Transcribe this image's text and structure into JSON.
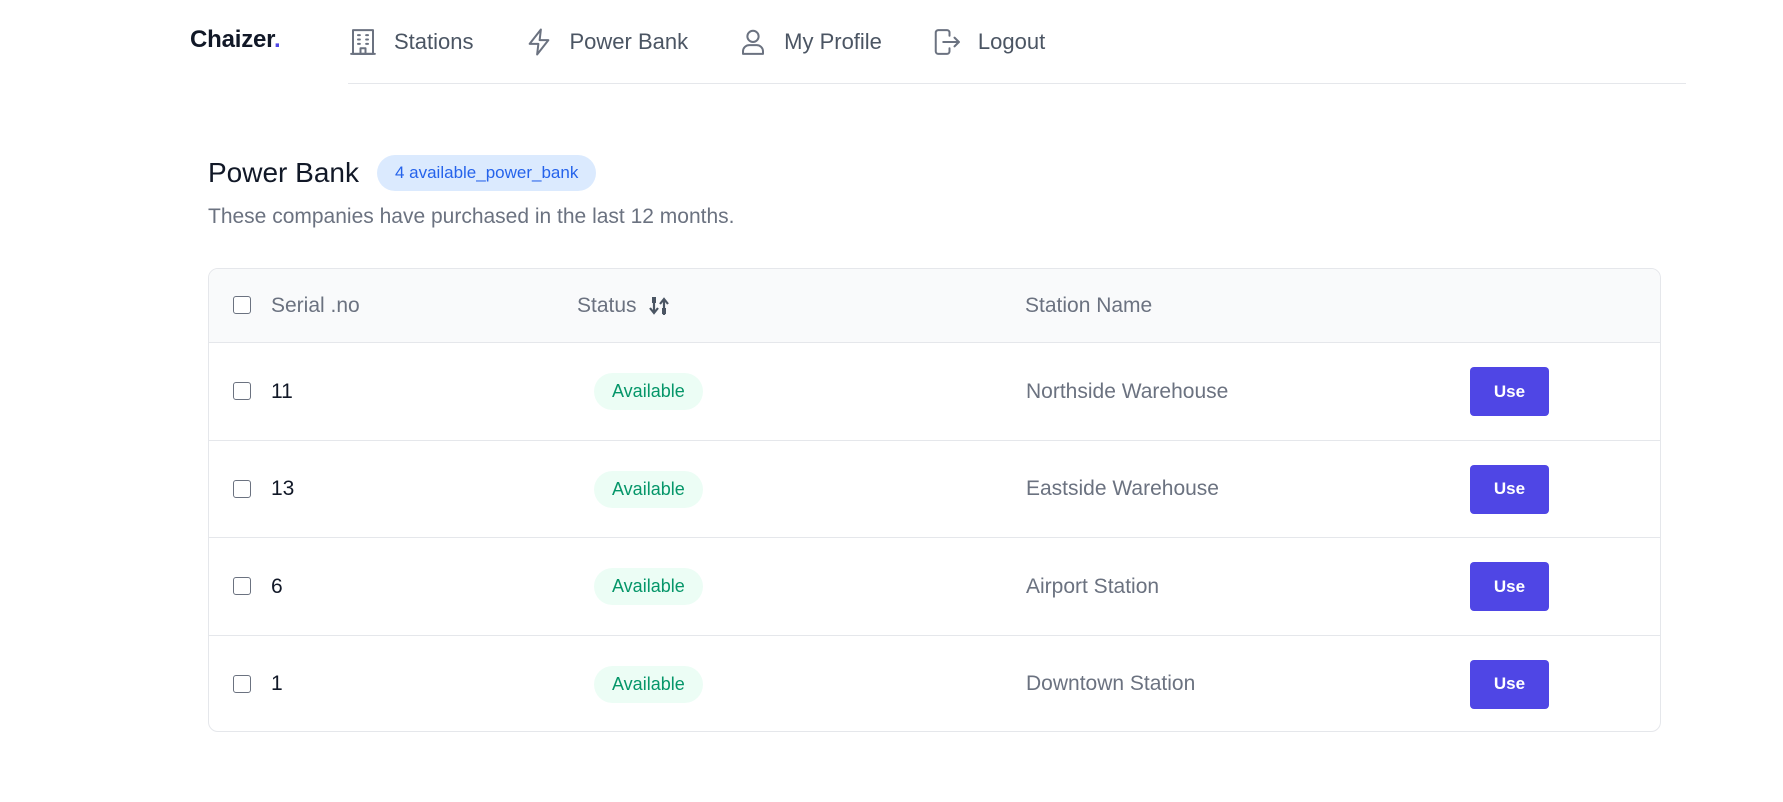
{
  "brand": {
    "name": "Chaizer",
    "dot": "."
  },
  "nav": {
    "items": [
      {
        "label": "Stations",
        "icon": "building-icon"
      },
      {
        "label": "Power Bank",
        "icon": "bolt-icon"
      },
      {
        "label": "My Profile",
        "icon": "user-icon"
      },
      {
        "label": "Logout",
        "icon": "logout-icon"
      }
    ]
  },
  "header": {
    "title": "Power Bank",
    "badge": "4 available_power_bank",
    "subtitle": "These companies have purchased in the last 12 months."
  },
  "table": {
    "columns": {
      "serial": "Serial .no",
      "status": "Status",
      "station": "Station Name"
    },
    "rows": [
      {
        "serial": "11",
        "status": "Available",
        "station": "Northside Warehouse",
        "action": "Use"
      },
      {
        "serial": "13",
        "status": "Available",
        "station": "Eastside Warehouse",
        "action": "Use"
      },
      {
        "serial": "6",
        "status": "Available",
        "station": "Airport Station",
        "action": "Use"
      },
      {
        "serial": "1",
        "status": "Available",
        "station": "Downtown Station",
        "action": "Use"
      }
    ]
  },
  "colors": {
    "accent": "#4f46e5",
    "badge_bg": "#dbeafe",
    "badge_text": "#2563eb",
    "status_bg": "#ecfdf5",
    "status_text": "#059669"
  }
}
